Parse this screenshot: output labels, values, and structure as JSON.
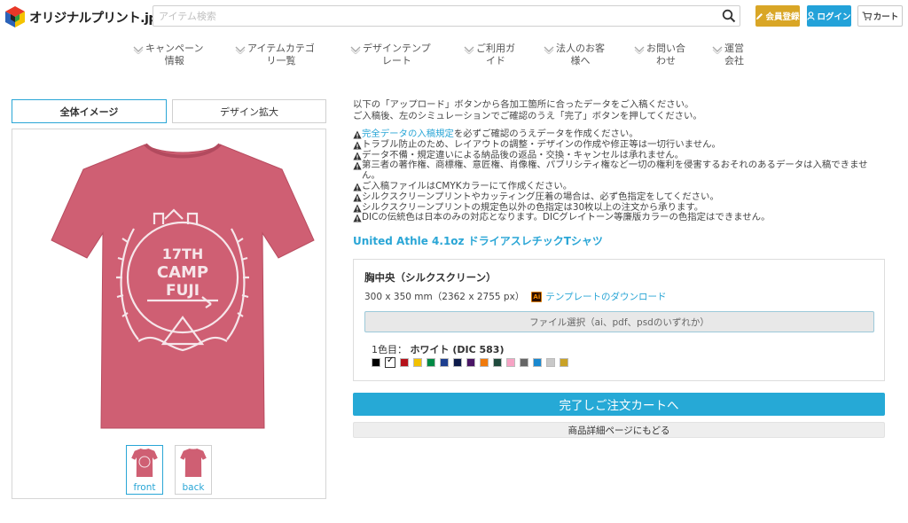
{
  "header": {
    "logo_text": "オリジナルプリント.jp",
    "search_placeholder": "アイテム検索",
    "register_label": "会員登録",
    "login_label": "ログイン",
    "cart_label": "カート"
  },
  "nav": {
    "items": [
      {
        "label": "キャンペーン\n情報"
      },
      {
        "label": "アイテムカテゴ\nリ一覧"
      },
      {
        "label": "デザインテンプ\nレート"
      },
      {
        "label": "ご利用ガ\nイド"
      },
      {
        "label": "法人のお客\n様へ"
      },
      {
        "label": "お問い合\nわせ"
      },
      {
        "label": "運営\n会社"
      }
    ]
  },
  "preview": {
    "tab_whole": "全体イメージ",
    "tab_zoom": "デザイン拡大",
    "shirt_color": "#cf5f73",
    "print_lines": [
      "17TH",
      "CAMP",
      "FUJI"
    ],
    "thumbs": [
      {
        "label": "front"
      },
      {
        "label": "back"
      }
    ]
  },
  "instructions": {
    "intro_line1": "以下の「アップロード」ボタンから各加工箇所に合ったデータをご入稿ください。",
    "intro_line2": "ご入稿後、左のシミュレーションでご確認のうえ「完了」ボタンを押してください。",
    "note1_link": "完全データの入稿規定",
    "note1_rest": "を必ずご確認のうえデータを作成ください。",
    "note2": "トラブル防止のため、レイアウトの調整・デザインの作成や修正等は一切行いません。",
    "note3": "データ不備・規定違いによる納品後の返品・交換・キャンセルは承れません。",
    "note4": "第三者の著作権、商標権、意匠権、肖像権、パブリシティ権など一切の権利を侵害するおそれのあるデータは入稿できません。",
    "note5": "ご入稿ファイルはCMYKカラーにて作成ください。",
    "note6": "シルクスクリーンプリントやカッティング圧着の場合は、必ず色指定をしてください。",
    "note7": "シルクスクリーンプリントの規定色以外の色指定は30枚以上の注文から承ります。",
    "note8": "DICの伝統色は日本のみの対応となります。DICグレイトーン等廉版カラーの色指定はできません。"
  },
  "product": {
    "title": "United Athle 4.1oz ドライアスレチックTシャツ"
  },
  "print_area": {
    "title": "胸中央（シルクスクリーン）",
    "size": "300 x 350 mm（2362 x 2755 px）",
    "ai_icon": "Ai",
    "template_link": "テンプレートのダウンロード",
    "file_select": "ファイル選択（ai、pdf、psdのいずれか）",
    "color_prefix": "1色目：",
    "color_selected": "ホワイト (DIC 583)",
    "swatches": [
      "#000000",
      "#ffffff",
      "#b5121b",
      "#f2c100",
      "#008a45",
      "#1d3f8f",
      "#0d1b4a",
      "#4a1666",
      "#f07a0c",
      "#1f4a3d",
      "#f6a3c4",
      "#666666",
      "#1a88cf",
      "#c8c8c8",
      "#c9a227"
    ]
  },
  "actions": {
    "checkout": "完了しご注文カートへ",
    "back": "商品詳細ページにもどる"
  },
  "colors": {
    "accent": "#26a9d6",
    "register": "#d9a626",
    "login": "#23a2d9"
  }
}
